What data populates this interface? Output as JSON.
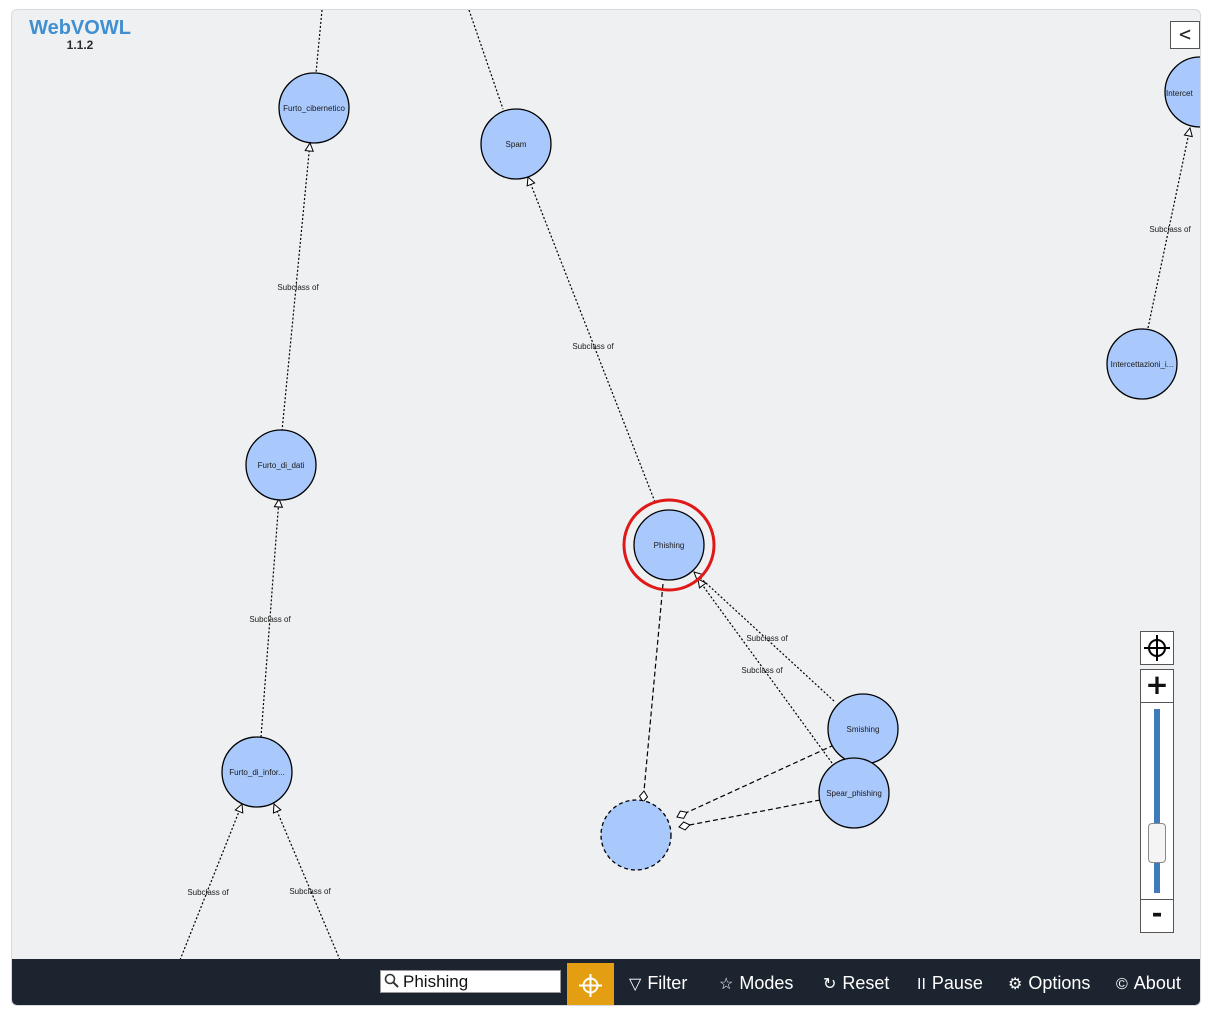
{
  "app": {
    "title": "WebVOWL",
    "version": "1.1.2"
  },
  "graph": {
    "nodes": [
      {
        "id": "furto_cibernetico",
        "label": "Furto_cibernetico"
      },
      {
        "id": "spam",
        "label": "Spam"
      },
      {
        "id": "furto_di_dati",
        "label": "Furto_di_dati"
      },
      {
        "id": "phishing",
        "label": "Phishing",
        "selected": true
      },
      {
        "id": "furto_di_infor",
        "label": "Furto_di_infor..."
      },
      {
        "id": "smishing",
        "label": "Smishing"
      },
      {
        "id": "spear_phishing",
        "label": "Spear_phishing"
      },
      {
        "id": "intercettazioni",
        "label": "Intercettazioni_i..."
      },
      {
        "id": "intercet_partial",
        "label": "Intercet"
      },
      {
        "id": "anonymous",
        "label": ""
      }
    ],
    "edge_label": "Subclass of"
  },
  "zoom": {
    "locate_icon": "crosshair-icon",
    "zoom_in": "+",
    "zoom_out": "-",
    "level": 0.22
  },
  "sidebar": {
    "toggle_label": "<"
  },
  "toolbar": {
    "search": {
      "value": "Phishing"
    },
    "filter_label": "Filter",
    "modes_label": "Modes",
    "reset_label": "Reset",
    "pause_label": "Pause",
    "options_label": "Options",
    "about_label": "About",
    "icons": {
      "filter": "▽",
      "modes": "☆",
      "reset": "↻",
      "pause": "II",
      "options": "⚙",
      "about": "©"
    }
  },
  "colors": {
    "node_fill": "#a9c8fb",
    "highlight_ring": "#e01818",
    "toolbar_bg": "#1c2430",
    "locate_button": "#e39f11",
    "brand": "#3f8fd1"
  }
}
